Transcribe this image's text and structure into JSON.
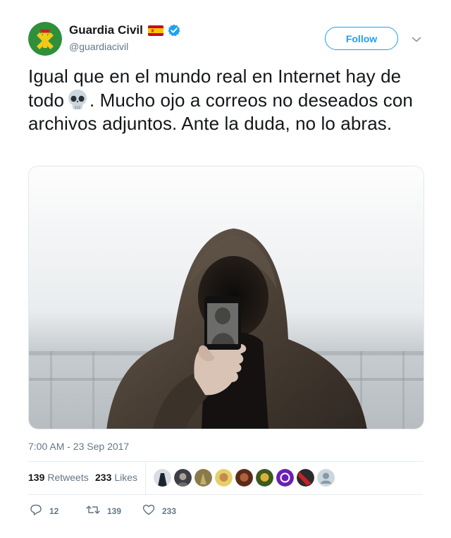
{
  "user": {
    "display_name": "Guardia Civil",
    "handle": "@guardiacivil",
    "verified": true,
    "flag_icon": "spain-flag-icon"
  },
  "follow_button": {
    "label": "Follow"
  },
  "tweet": {
    "text_before_emoji": "Igual que en el mundo real en Internet hay de todo",
    "emoji": "skull-emoji",
    "text_after_emoji": ". Mucho ojo a correos no deseados con archivos adjuntos. Ante la duda, no lo abras.",
    "timestamp": "7:00 AM - 23 Sep 2017"
  },
  "stats": {
    "retweets_count": "139",
    "retweets_label": "Retweets",
    "likes_count": "233",
    "likes_label": "Likes",
    "liker_avatar_count": 9
  },
  "actions": {
    "reply_count": "12",
    "retweet_count": "139",
    "like_count": "233"
  },
  "colors": {
    "accent": "#1da1f2",
    "secondary_text": "#657786",
    "primary_text": "#14171a",
    "brand_green": "#2e8b3a"
  }
}
